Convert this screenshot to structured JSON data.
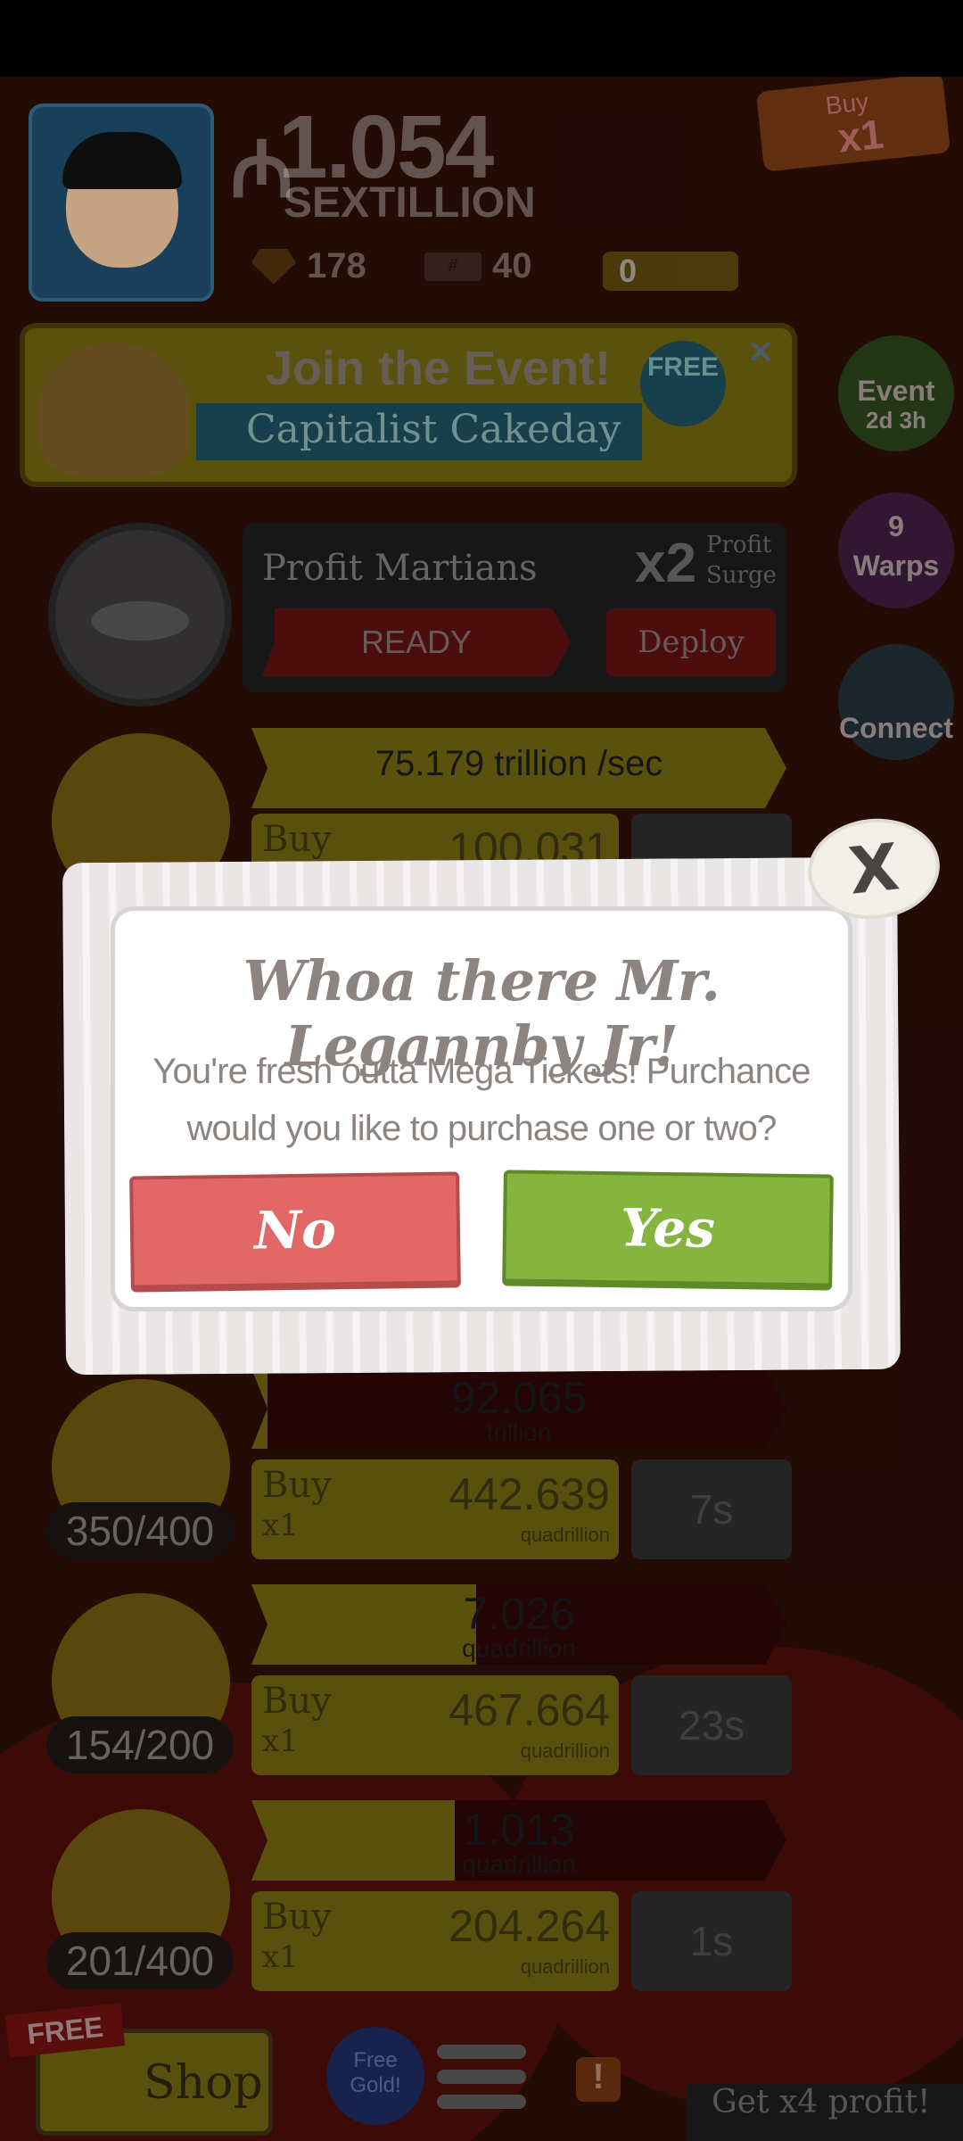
{
  "header": {
    "money_value": "1.054",
    "money_unit": "SEXTILLION",
    "gold_count": "178",
    "mega_tickets": "40",
    "tickets": "0",
    "buy_multiplier_label": "Buy",
    "buy_multiplier_value": "x1"
  },
  "event_banner": {
    "title": "Join the Event!",
    "subtitle": "Capitalist Cakeday",
    "free_label": "FREE"
  },
  "side_badges": [
    {
      "label": "Event",
      "sub": "2d 3h"
    },
    {
      "label": "Warps",
      "count": "9"
    },
    {
      "label": "Connect"
    }
  ],
  "manager_card": {
    "name": "Profit Martians",
    "multiplier": "x2",
    "surge_line1": "Profit",
    "surge_line2": "Surge",
    "ready_label": "READY",
    "deploy_label": "Deploy"
  },
  "businesses": [
    {
      "rate": "75.179 trillion /sec",
      "buy_label": "Buy",
      "buy_price": "100.031"
    },
    {
      "rate": "92.065",
      "rate_unit": "trillion",
      "count": "350/400",
      "buy_label": "Buy",
      "mult": "x1",
      "price": "442.639",
      "price_unit": "quadrillion",
      "timer": "7s"
    },
    {
      "rate": "7.026",
      "rate_unit": "quadrillion",
      "count": "154/200",
      "buy_label": "Buy",
      "mult": "x1",
      "price": "467.664",
      "price_unit": "quadrillion",
      "timer": "23s"
    },
    {
      "rate": "1.013",
      "rate_unit": "quadrillion",
      "count": "201/400",
      "buy_label": "Buy",
      "mult": "x1",
      "price": "204.264",
      "price_unit": "quadrillion",
      "timer": "1s"
    }
  ],
  "bottom_bar": {
    "free_ribbon": "FREE",
    "shop_label": "Shop",
    "free_gold_label": "Free Gold!",
    "alert_label": "!",
    "x4_label": "Get x4 profit!"
  },
  "dialog": {
    "title": "Whoa there Mr. Legannby Jr!",
    "body": "You're fresh outta Mega Tickets! Purchance would you like to purchase one or two?",
    "no_label": "No",
    "yes_label": "Yes",
    "close_label": "X"
  }
}
